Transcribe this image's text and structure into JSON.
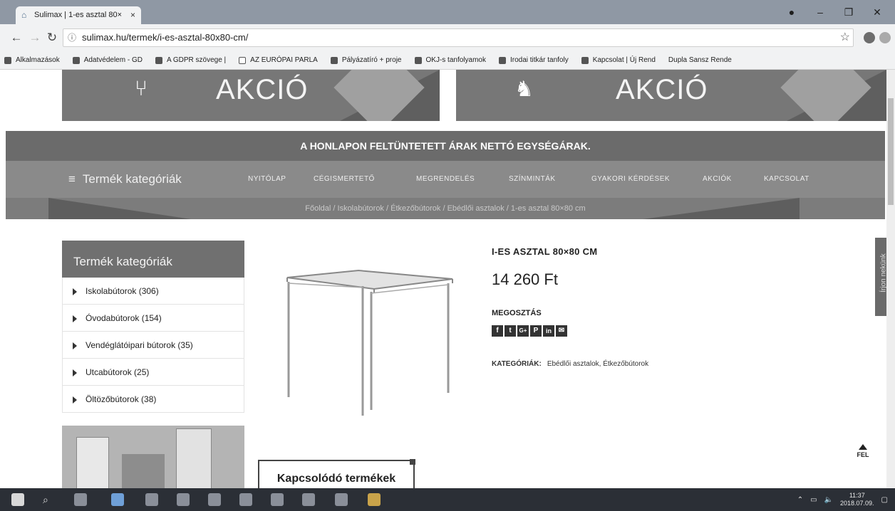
{
  "browser": {
    "tab_title": "Sulimax | 1-es asztal 80×",
    "tab_close": "×",
    "url": "sulimax.hu/termek/i-es-asztal-80x80-cm/",
    "bookmarks": [
      "Alkalmazások",
      "Adatvédelem - GD",
      "A GDPR szövege |",
      "AZ EURÓPAI PARLA",
      "Pályázatíró + proje",
      "OKJ-s tanfolyamok",
      "Irodai titkár tanfoly",
      "Kapcsolat | Új Rend",
      "Dupla Sansz Rende"
    ]
  },
  "banners": [
    {
      "title": "AKCIÓ",
      "icon": "school-chair-icon"
    },
    {
      "title": "AKCIÓ",
      "icon": "rocking-horse-icon"
    }
  ],
  "notice": "A HONLAPON FELTÜNTETETT ÁRAK NETTÓ EGYSÉGÁRAK.",
  "nav": {
    "categories_label": "Termék kategóriák",
    "items": [
      "NYITÓLAP",
      "CÉGISMERTETŐ",
      "MEGRENDELÉS",
      "SZÍNMINTÁK",
      "GYAKORI KÉRDÉSEK",
      "AKCIÓK",
      "KAPCSOLAT"
    ]
  },
  "breadcrumb": "Főoldal / Iskolabútorok / Étkezőbútorok / Ebédlői asztalok / 1-es asztal 80×80 cm",
  "sidebar": {
    "title": "Termék kategóriák",
    "items": [
      "Iskolabútorok (306)",
      "Óvodabútorok (154)",
      "Vendéglátóipari bútorok (35)",
      "Utcabútorok (25)",
      "Öltözőbútorok (38)"
    ]
  },
  "product": {
    "title": "I-ES ASZTAL 80×80 CM",
    "price": "14 260 Ft",
    "share_label": "MEGOSZTÁS",
    "share_icons": [
      "f",
      "t",
      "G+",
      "P",
      "in",
      "✉"
    ],
    "categories_label": "KATEGÓRIÁK:",
    "categories_value": "Ebédlői asztalok, Étkezőbútorok"
  },
  "related_title": "Kapcsolódó termékek",
  "contact_tab": "Írjon nekünk",
  "totop": "FEL",
  "taskbar": {
    "time": "11:37",
    "date": "2018.07.09."
  }
}
